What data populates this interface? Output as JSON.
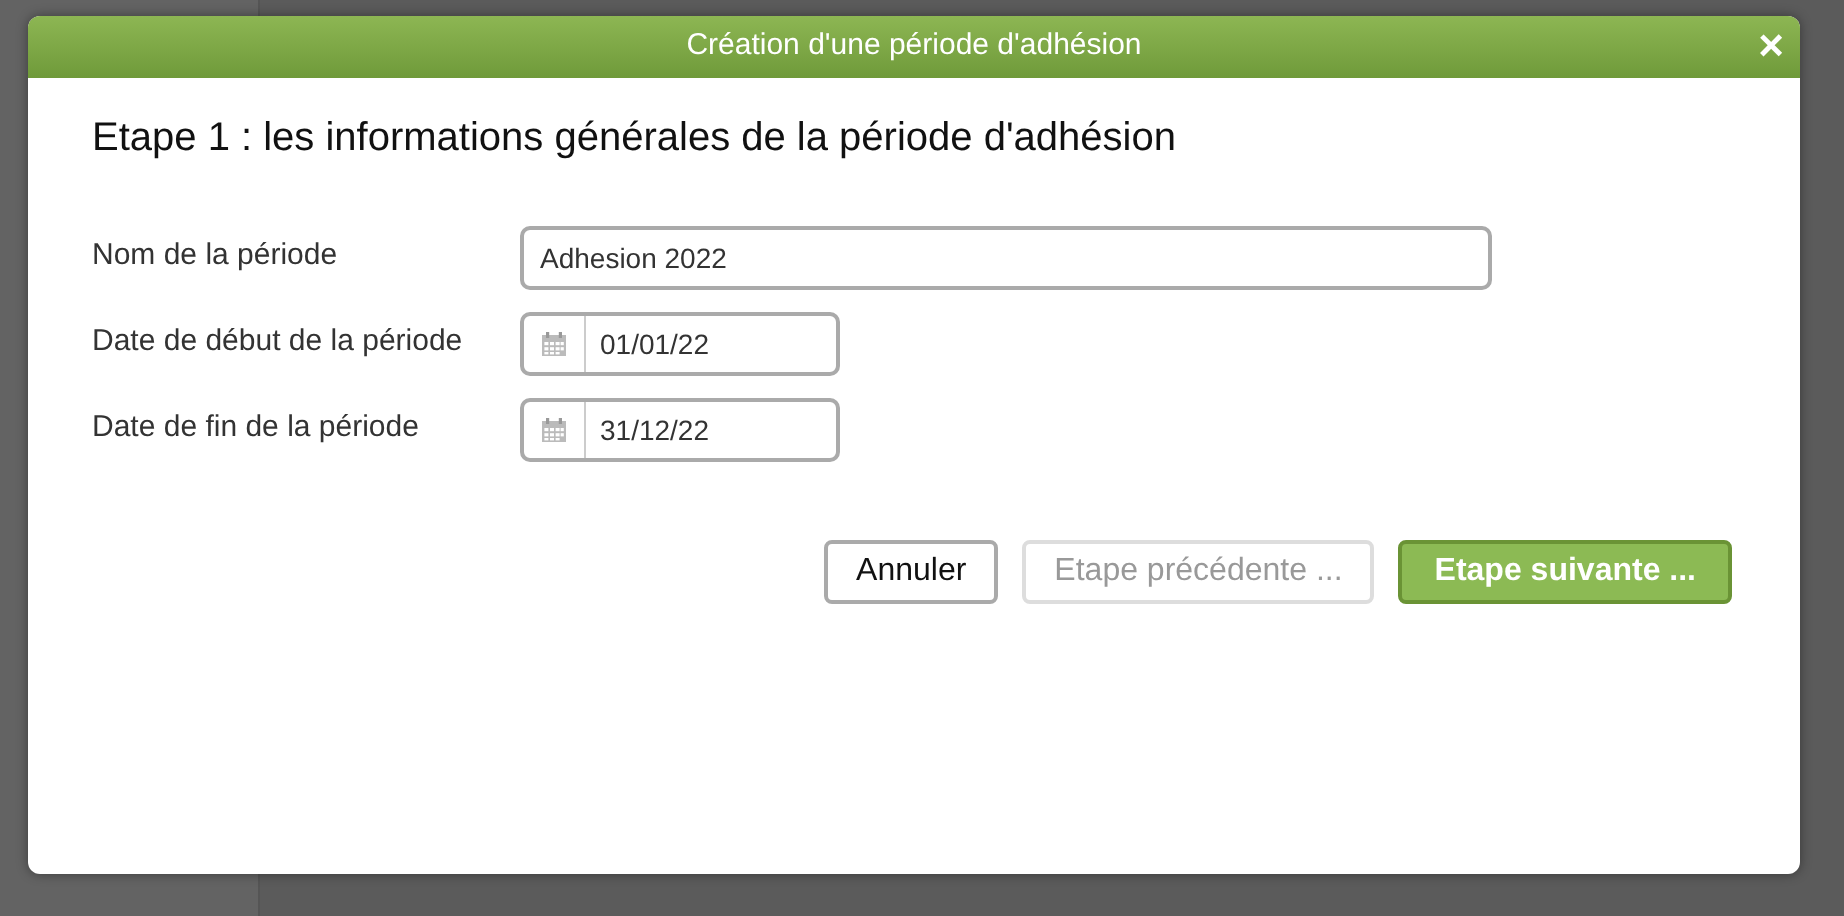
{
  "dialog": {
    "title": "Création d'une période d'adhésion",
    "close": "×",
    "heading": "Etape 1 : les informations générales de la période d'adhésion",
    "fields": [
      {
        "label": "Nom de la période",
        "kind": "text",
        "value": "Adhesion 2022"
      },
      {
        "label": "Date de début de la période",
        "kind": "date",
        "value": "01/01/22"
      },
      {
        "label": "Date de fin de la période",
        "kind": "date",
        "value": "31/12/22"
      }
    ],
    "buttons": [
      {
        "label": "Annuler",
        "kind": "default",
        "disabled": false
      },
      {
        "label": "Etape précédente ...",
        "kind": "default",
        "disabled": true
      },
      {
        "label": "Etape suivante ...",
        "kind": "primary",
        "disabled": false
      }
    ]
  }
}
